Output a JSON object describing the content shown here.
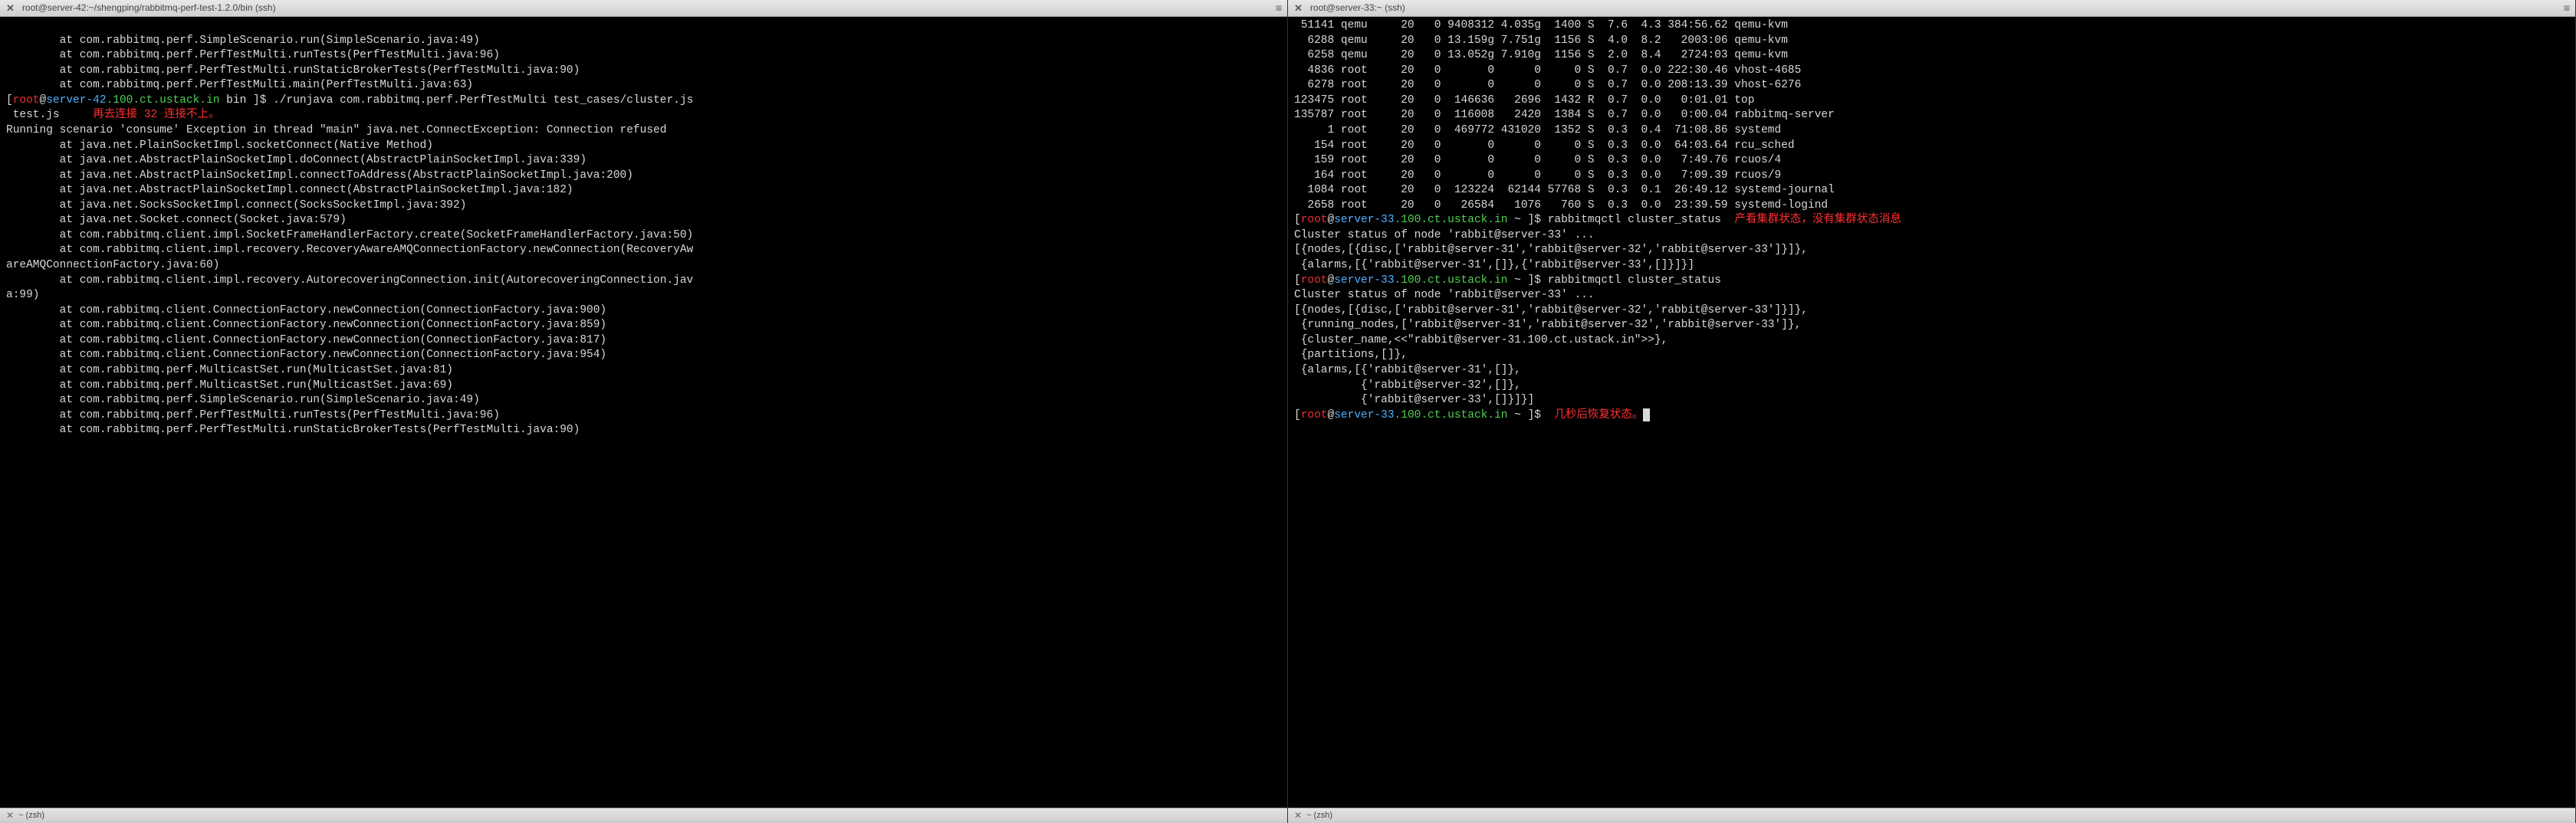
{
  "left": {
    "title": "root@server-42:~/shengping/rabbitmq-perf-test-1.2.0/bin (ssh)",
    "status": "~ (zsh)",
    "lines": {
      "l0": "        at com.rabbitmq.perf.SimpleScenario.run(SimpleScenario.java:49)",
      "l1": "        at com.rabbitmq.perf.PerfTestMulti.runTests(PerfTestMulti.java:96)",
      "l2": "        at com.rabbitmq.perf.PerfTestMulti.runStaticBrokerTests(PerfTestMulti.java:90)",
      "l3": "        at com.rabbitmq.perf.PerfTestMulti.main(PerfTestMulti.java:63)",
      "cmd": "./runjava com.rabbitmq.perf.PerfTestMulti test_cases/cluster.js",
      "l5": " test.js",
      "note": "再去连接 32 连接不上。",
      "l6": "Running scenario 'consume' Exception in thread \"main\" java.net.ConnectException: Connection refused",
      "l7": "        at java.net.PlainSocketImpl.socketConnect(Native Method)",
      "l8": "        at java.net.AbstractPlainSocketImpl.doConnect(AbstractPlainSocketImpl.java:339)",
      "l9": "        at java.net.AbstractPlainSocketImpl.connectToAddress(AbstractPlainSocketImpl.java:200)",
      "l10": "        at java.net.AbstractPlainSocketImpl.connect(AbstractPlainSocketImpl.java:182)",
      "l11": "        at java.net.SocksSocketImpl.connect(SocksSocketImpl.java:392)",
      "l12": "        at java.net.Socket.connect(Socket.java:579)",
      "l13": "        at com.rabbitmq.client.impl.SocketFrameHandlerFactory.create(SocketFrameHandlerFactory.java:50)",
      "l14": "        at com.rabbitmq.client.impl.recovery.RecoveryAwareAMQConnectionFactory.newConnection(RecoveryAw",
      "l15": "areAMQConnectionFactory.java:60)",
      "l16": "        at com.rabbitmq.client.impl.recovery.AutorecoveringConnection.init(AutorecoveringConnection.jav",
      "l17": "a:99)",
      "l18": "        at com.rabbitmq.client.ConnectionFactory.newConnection(ConnectionFactory.java:900)",
      "l19": "        at com.rabbitmq.client.ConnectionFactory.newConnection(ConnectionFactory.java:859)",
      "l20": "        at com.rabbitmq.client.ConnectionFactory.newConnection(ConnectionFactory.java:817)",
      "l21": "        at com.rabbitmq.client.ConnectionFactory.newConnection(ConnectionFactory.java:954)",
      "l22": "        at com.rabbitmq.perf.MulticastSet.run(MulticastSet.java:81)",
      "l23": "        at com.rabbitmq.perf.MulticastSet.run(MulticastSet.java:69)",
      "l24": "        at com.rabbitmq.perf.SimpleScenario.run(SimpleScenario.java:49)",
      "l25": "        at com.rabbitmq.perf.PerfTestMulti.runTests(PerfTestMulti.java:96)",
      "l26": "        at com.rabbitmq.perf.PerfTestMulti.runStaticBrokerTests(PerfTestMulti.java:90)"
    },
    "prompt": {
      "root": "root",
      "at": "@",
      "host": "server-42",
      "domain": ".100.ct.ustack.in",
      "cwd": " bin",
      "dollar": " ]$ "
    }
  },
  "right": {
    "title": "root@server-33:~ (ssh)",
    "status": "~ (zsh)",
    "top_rows": [
      {
        "pid": " 51141",
        "user": "qemu",
        "pr": "   20",
        "ni": "  0",
        "virt": "9408312",
        "res": "4.035g",
        "shr": " 1400",
        "s": "S",
        "cpu": " 7.6",
        "mem": " 4.3",
        "time": "384:56.62",
        "cmd": "qemu-kvm"
      },
      {
        "pid": "  6288",
        "user": "qemu",
        "pr": "   20",
        "ni": "  0",
        "virt": "13.159g",
        "res": "7.751g",
        "shr": " 1156",
        "s": "S",
        "cpu": " 4.0",
        "mem": " 8.2",
        "time": " 2003:06",
        "cmd": "qemu-kvm"
      },
      {
        "pid": "  6258",
        "user": "qemu",
        "pr": "   20",
        "ni": "  0",
        "virt": "13.052g",
        "res": "7.910g",
        "shr": " 1156",
        "s": "S",
        "cpu": " 2.0",
        "mem": " 8.4",
        "time": " 2724:03",
        "cmd": "qemu-kvm"
      },
      {
        "pid": "  4836",
        "user": "root",
        "pr": "   20",
        "ni": "  0",
        "virt": "      0",
        "res": "     0",
        "shr": "    0",
        "s": "S",
        "cpu": " 0.7",
        "mem": " 0.0",
        "time": "222:30.46",
        "cmd": "vhost-4685"
      },
      {
        "pid": "  6278",
        "user": "root",
        "pr": "   20",
        "ni": "  0",
        "virt": "      0",
        "res": "     0",
        "shr": "    0",
        "s": "S",
        "cpu": " 0.7",
        "mem": " 0.0",
        "time": "208:13.39",
        "cmd": "vhost-6276"
      },
      {
        "pid": "123475",
        "user": "root",
        "pr": "   20",
        "ni": "  0",
        "virt": " 146636",
        "res": "  2696",
        "shr": " 1432",
        "s": "R",
        "cpu": " 0.7",
        "mem": " 0.0",
        "time": " 0:01.01",
        "cmd": "top",
        "bold": true
      },
      {
        "pid": "135787",
        "user": "root",
        "pr": "   20",
        "ni": "  0",
        "virt": " 116008",
        "res": "  2420",
        "shr": " 1384",
        "s": "S",
        "cpu": " 0.7",
        "mem": " 0.0",
        "time": " 0:00.04",
        "cmd": "rabbitmq-server"
      },
      {
        "pid": "     1",
        "user": "root",
        "pr": "   20",
        "ni": "  0",
        "virt": " 469772",
        "res": "431020",
        "shr": " 1352",
        "s": "S",
        "cpu": " 0.3",
        "mem": " 0.4",
        "time": "71:08.86",
        "cmd": "systemd"
      },
      {
        "pid": "   154",
        "user": "root",
        "pr": "   20",
        "ni": "  0",
        "virt": "      0",
        "res": "     0",
        "shr": "    0",
        "s": "S",
        "cpu": " 0.3",
        "mem": " 0.0",
        "time": "64:03.64",
        "cmd": "rcu_sched"
      },
      {
        "pid": "   159",
        "user": "root",
        "pr": "   20",
        "ni": "  0",
        "virt": "      0",
        "res": "     0",
        "shr": "    0",
        "s": "S",
        "cpu": " 0.3",
        "mem": " 0.0",
        "time": " 7:49.76",
        "cmd": "rcuos/4"
      },
      {
        "pid": "   164",
        "user": "root",
        "pr": "   20",
        "ni": "  0",
        "virt": "      0",
        "res": "     0",
        "shr": "    0",
        "s": "S",
        "cpu": " 0.3",
        "mem": " 0.0",
        "time": " 7:09.39",
        "cmd": "rcuos/9"
      },
      {
        "pid": "  1084",
        "user": "root",
        "pr": "   20",
        "ni": "  0",
        "virt": " 123224",
        "res": " 62144",
        "shr": "57768",
        "s": "S",
        "cpu": " 0.3",
        "mem": " 0.1",
        "time": "26:49.12",
        "cmd": "systemd-journal"
      },
      {
        "pid": "  2658",
        "user": "root",
        "pr": "   20",
        "ni": "  0",
        "virt": "  26584",
        "res": "  1076",
        "shr": "  760",
        "s": "S",
        "cpu": " 0.3",
        "mem": " 0.0",
        "time": "23:39.59",
        "cmd": "systemd-logind"
      }
    ],
    "prompt": {
      "root": "root",
      "at": "@",
      "host": "server-33",
      "domain": ".100.ct.ustack.in",
      "cwd": " ~",
      "dollar": " ]$ "
    },
    "cmd1": "rabbitmqctl cluster_status",
    "note1": "产看集群状态，没有集群状态消息",
    "out1a": "Cluster status of node 'rabbit@server-33' ...",
    "out1b": "[{nodes,[{disc,['rabbit@server-31','rabbit@server-32','rabbit@server-33']}]},",
    "out1c": " {alarms,[{'rabbit@server-31',[]},{'rabbit@server-33',[]}]}]",
    "cmd2": "rabbitmqctl cluster_status",
    "out2a": "Cluster status of node 'rabbit@server-33' ...",
    "out2b": "[{nodes,[{disc,['rabbit@server-31','rabbit@server-32','rabbit@server-33']}]},",
    "out2c": " {running_nodes,['rabbit@server-31','rabbit@server-32','rabbit@server-33']},",
    "out2d": " {cluster_name,<<\"rabbit@server-31.100.ct.ustack.in\">>},",
    "out2e": " {partitions,[]},",
    "out2f": " {alarms,[{'rabbit@server-31',[]},",
    "out2g": "          {'rabbit@server-32',[]},",
    "out2h": "          {'rabbit@server-33',[]}]}]",
    "note2": "几秒后恢复状态。"
  }
}
